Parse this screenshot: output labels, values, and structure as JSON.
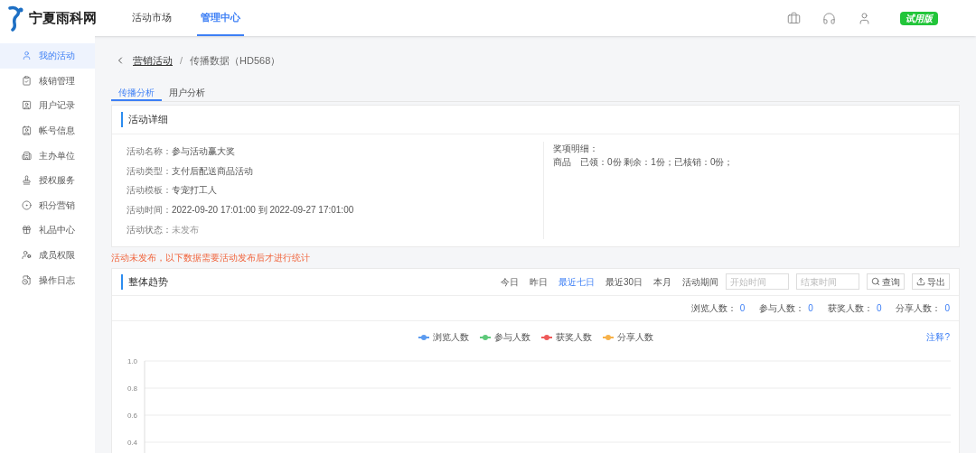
{
  "brand": {
    "name": "宁夏雨科网"
  },
  "top_nav": [
    {
      "label": "活动市场",
      "selected": false
    },
    {
      "label": "管理中心",
      "selected": true
    }
  ],
  "header_badge": "试用版",
  "sidebar": {
    "items": [
      {
        "label": "我的活动",
        "selected": true
      },
      {
        "label": "核销管理",
        "selected": false
      },
      {
        "label": "用户记录",
        "selected": false
      },
      {
        "label": "帐号信息",
        "selected": false
      },
      {
        "label": "主办单位",
        "selected": false
      },
      {
        "label": "授权服务",
        "selected": false
      },
      {
        "label": "积分营销",
        "selected": false
      },
      {
        "label": "礼品中心",
        "selected": false
      },
      {
        "label": "成员权限",
        "selected": false
      },
      {
        "label": "操作日志",
        "selected": false
      }
    ]
  },
  "breadcrumb": {
    "link": "营销活动",
    "separator": "/",
    "current": "传播数据（HD568）"
  },
  "tabs": [
    {
      "label": "传播分析",
      "selected": true
    },
    {
      "label": "用户分析",
      "selected": false
    }
  ],
  "details": {
    "title": "活动详细",
    "fields": [
      {
        "label": "活动名称：",
        "value": "参与活动赢大奖"
      },
      {
        "label": "活动类型：",
        "value": "支付后配送商品活动"
      },
      {
        "label": "活动模板：",
        "value": "专宠打工人"
      },
      {
        "label": "活动时间：",
        "value": "2022-09-20 17:01:00 到 2022-09-27 17:01:00"
      },
      {
        "label": "活动状态：",
        "value": "未发布"
      }
    ],
    "prize_title": "奖项明细：",
    "prize_line": "商品　已领：0份 剩余：1份；已核销：0份；"
  },
  "warning": "活动未发布，以下数据需要活动发布后才进行统计",
  "trend": {
    "title": "整体趋势",
    "ranges": [
      {
        "label": "今日",
        "selected": false
      },
      {
        "label": "昨日",
        "selected": false
      },
      {
        "label": "最近七日",
        "selected": true
      },
      {
        "label": "最近30日",
        "selected": false
      },
      {
        "label": "本月",
        "selected": false
      },
      {
        "label": "活动期间",
        "selected": false
      }
    ],
    "start_placeholder": "开始时间",
    "end_placeholder": "结束时间",
    "query_button": "查询",
    "export_button": "导出",
    "stats": [
      {
        "label": "浏览人数：",
        "value": "0"
      },
      {
        "label": "参与人数：",
        "value": "0"
      },
      {
        "label": "获奖人数：",
        "value": "0"
      },
      {
        "label": "分享人数：",
        "value": "0"
      }
    ],
    "note_link": "注释?",
    "chart_data": {
      "type": "line",
      "ylim": [
        0.4,
        1.0
      ],
      "yticks": [
        {
          "value": 0.4,
          "label": "0.4"
        },
        {
          "value": 0.6,
          "label": "0.6"
        },
        {
          "value": 0.8,
          "label": "0.8"
        },
        {
          "value": 1.0,
          "label": "1.0"
        }
      ],
      "series": [
        {
          "name": "浏览人数",
          "color": "#5b9bf0"
        },
        {
          "name": "参与人数",
          "color": "#5ec97a"
        },
        {
          "name": "获奖人数",
          "color": "#ee5a5a"
        },
        {
          "name": "分享人数",
          "color": "#f7b24a"
        }
      ]
    }
  }
}
